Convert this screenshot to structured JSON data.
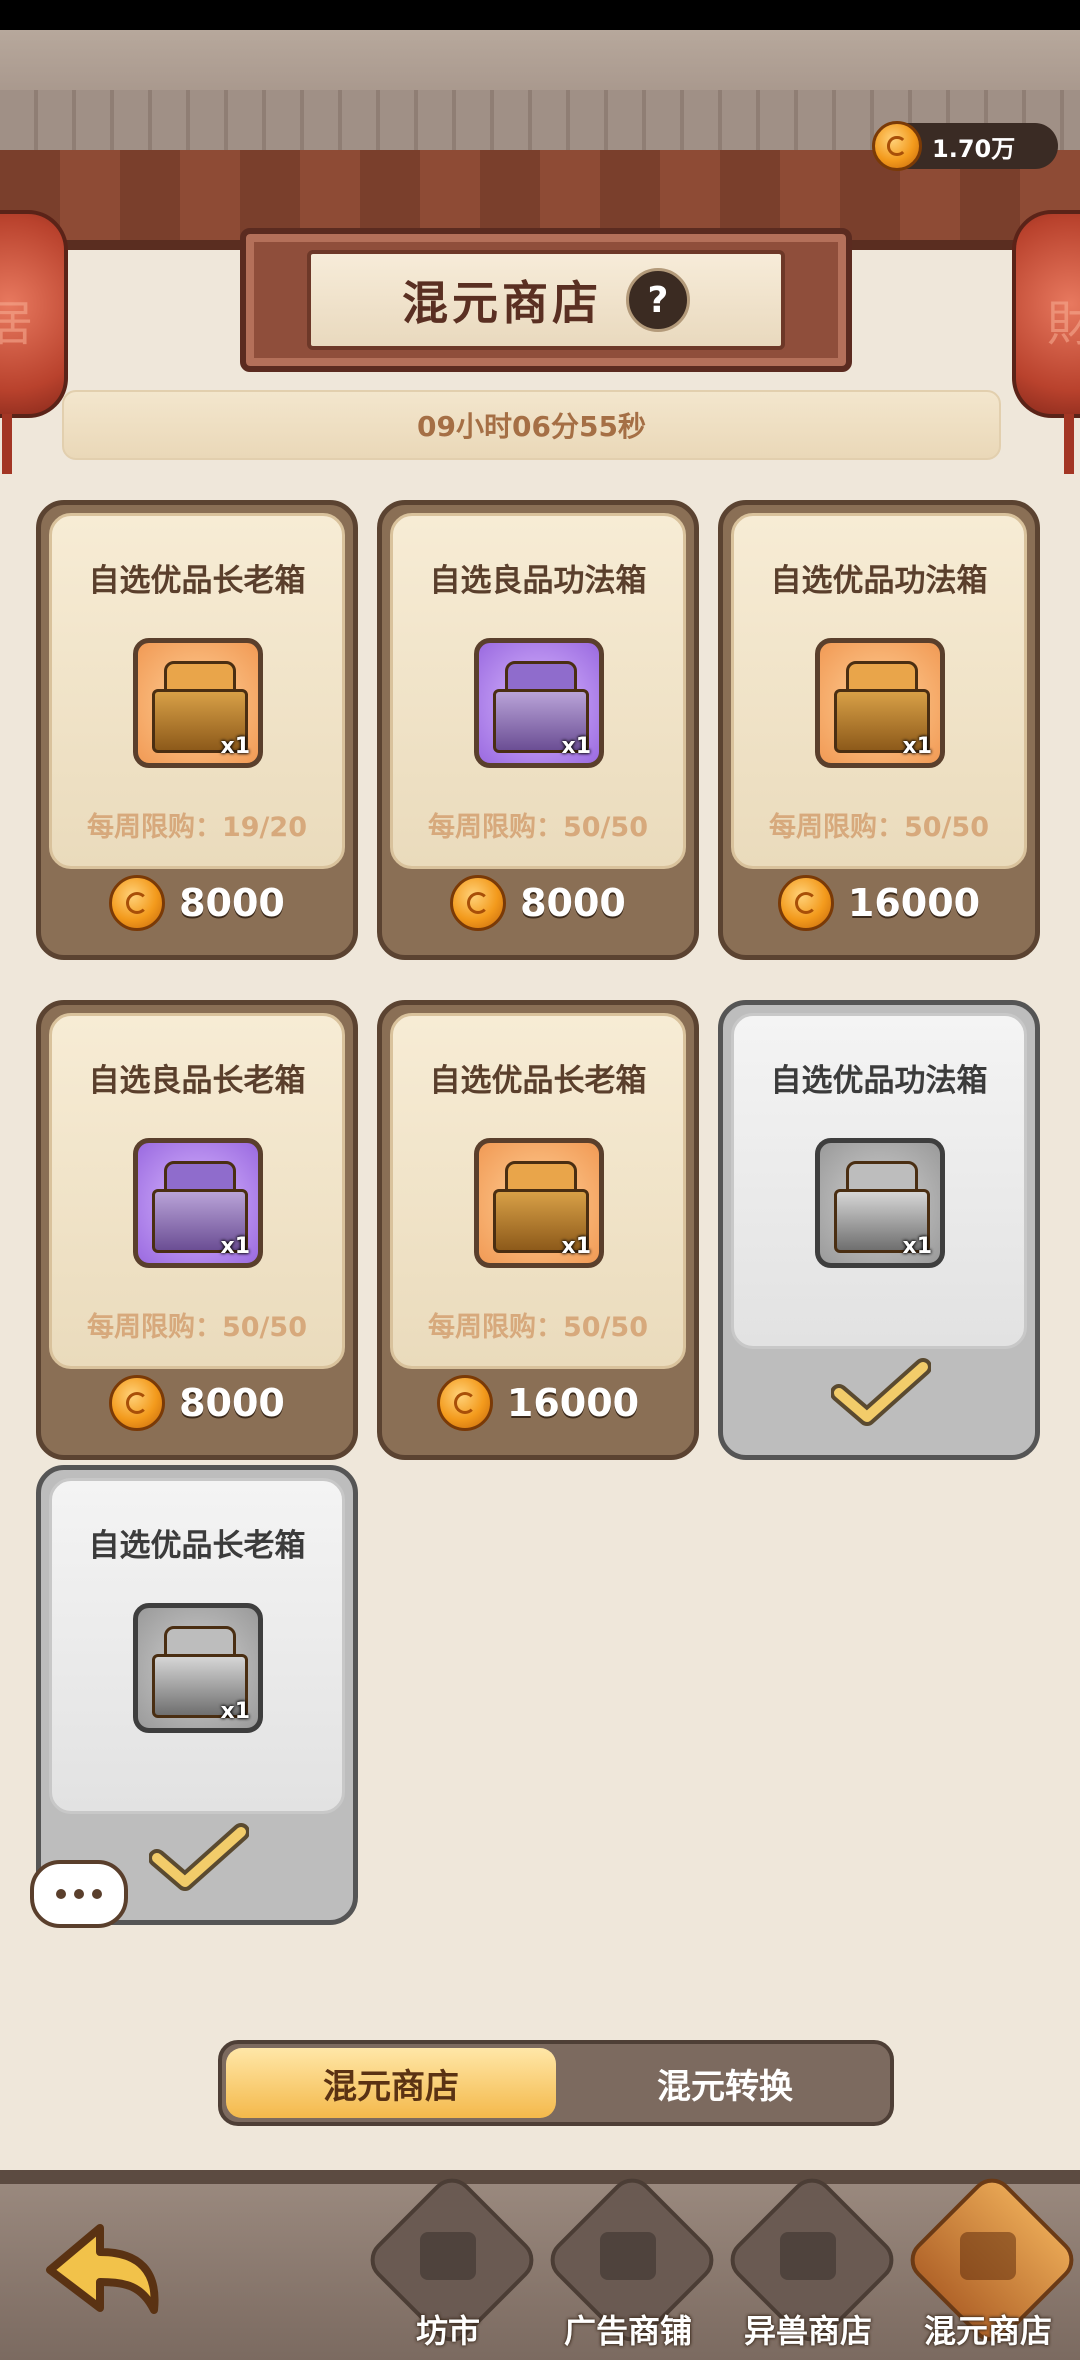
{
  "currency": {
    "amount": "1.70万"
  },
  "lanterns": {
    "left": "居",
    "right": "財"
  },
  "header": {
    "title": "混元商店",
    "help": "?"
  },
  "timer": {
    "text": "09小时06分55秒"
  },
  "items": [
    {
      "name": "自选优品长老箱",
      "limit": "每周限购：19/20",
      "price": "8000",
      "qty": "x1"
    },
    {
      "name": "自选良品功法箱",
      "limit": "每周限购：50/50",
      "price": "8000",
      "qty": "x1"
    },
    {
      "name": "自选优品功法箱",
      "limit": "每周限购：50/50",
      "price": "16000",
      "qty": "x1"
    },
    {
      "name": "自选良品长老箱",
      "limit": "每周限购：50/50",
      "price": "8000",
      "qty": "x1"
    },
    {
      "name": "自选优品长老箱",
      "limit": "每周限购：50/50",
      "price": "16000",
      "qty": "x1"
    },
    {
      "name": "自选优品功法箱",
      "qty": "x1",
      "sold_out": true
    },
    {
      "name": "自选优品长老箱",
      "qty": "x1",
      "sold_out": true
    }
  ],
  "tabs": [
    {
      "label": "混元商店",
      "active": true
    },
    {
      "label": "混元转换",
      "active": false
    }
  ],
  "nav": [
    {
      "label": "坊市"
    },
    {
      "label": "广告商铺"
    },
    {
      "label": "异兽商店"
    },
    {
      "label": "混元商店",
      "active": true
    }
  ],
  "colors": {
    "coin": "#f39a1c",
    "card_border": "#5b4331",
    "plaque": "#8f4e3b"
  }
}
